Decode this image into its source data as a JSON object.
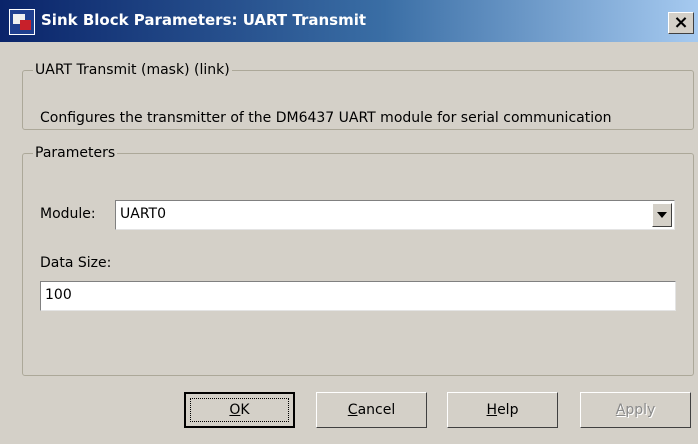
{
  "window": {
    "title": "Sink Block Parameters: UART Transmit",
    "close_glyph": "×"
  },
  "description": {
    "legend": "UART Transmit (mask) (link)",
    "text": "Configures the transmitter of the DM6437 UART module for serial communication"
  },
  "parameters": {
    "legend": "Parameters",
    "module": {
      "label": "Module:",
      "value": "UART0"
    },
    "data_size": {
      "label": "Data Size:",
      "value": "100"
    }
  },
  "buttons": {
    "ok": {
      "mnemonic": "O",
      "rest": "K"
    },
    "cancel": {
      "mnemonic": "C",
      "rest": "ancel"
    },
    "help": {
      "mnemonic": "H",
      "rest": "elp"
    },
    "apply": {
      "mnemonic": "A",
      "rest": "pply"
    }
  },
  "icons": {
    "app": "simulink-block-icon",
    "close": "close-icon",
    "dropdown": "chevron-down-icon"
  }
}
